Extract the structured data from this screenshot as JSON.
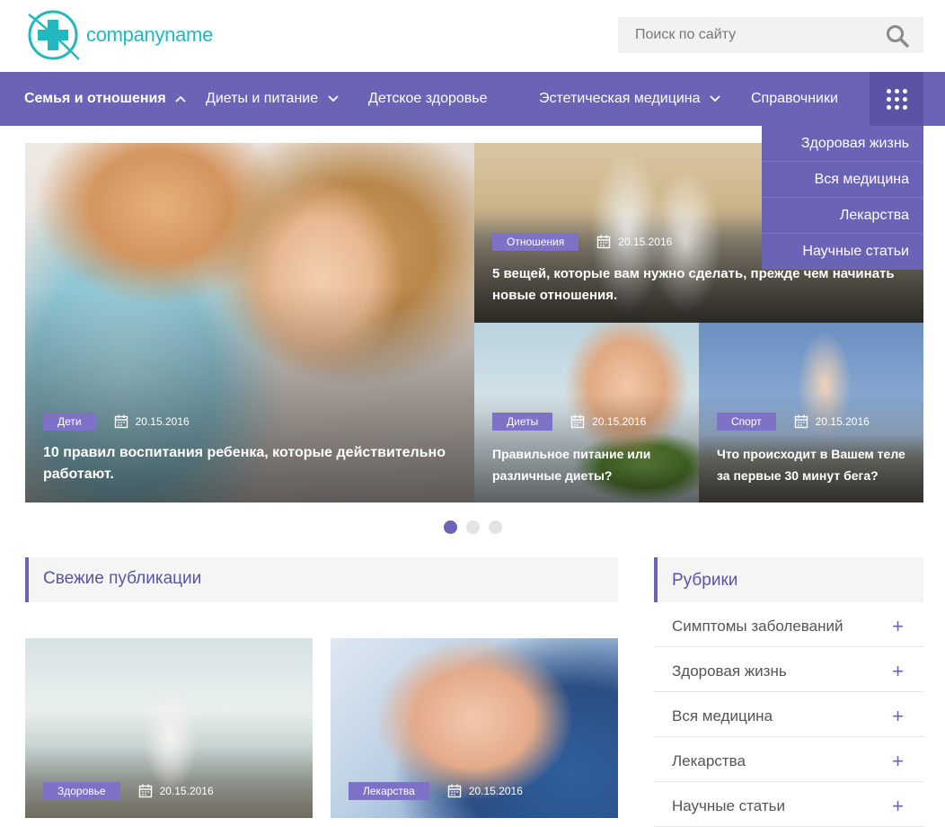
{
  "brand": {
    "name": "companyname",
    "accent": "#23b8c0",
    "nav_color": "#6b63b5"
  },
  "search": {
    "placeholder": "Поиск по сайту",
    "icon": "search-icon"
  },
  "nav": {
    "items": [
      {
        "label": "Семья и отношения",
        "active": true,
        "chevron": "up"
      },
      {
        "label": "Диеты и питание",
        "chevron": "down"
      },
      {
        "label": "Детское здоровье"
      },
      {
        "label": "Эстетическая медицина",
        "chevron": "down"
      },
      {
        "label": "Справочники"
      }
    ],
    "more_icon": "grid-icon"
  },
  "dropdown": {
    "items": [
      "Здоровая жизнь",
      "Вся медицина",
      "Лекарства",
      "Научные статьи"
    ]
  },
  "slider": {
    "tiles": [
      {
        "category": "Дети",
        "date": "20.15.2016",
        "title": "10 правил воспитания ребенка, которые действительно работают."
      },
      {
        "category": "Отношения",
        "date": "20.15.2016",
        "title": "5 вещей, которые вам нужно сделать, прежде чем начинать новые отношения."
      },
      {
        "category": "Диеты",
        "date": "20.15.2016",
        "title": "Правильное питание или различные диеты?"
      },
      {
        "category": "Спорт",
        "date": "20.15.2016",
        "title": "Что происходит в Вашем теле за первые 30 минут бега?"
      }
    ],
    "pages": 3,
    "current_page": 1
  },
  "fresh": {
    "heading": "Свежие публикации",
    "cards": [
      {
        "category": "Здоровье",
        "date": "20.15.2016"
      },
      {
        "category": "Лекарства",
        "date": "20.15.2016"
      }
    ]
  },
  "rubrics": {
    "heading": "Рубрики",
    "items": [
      "Симптомы заболеваний",
      "Здоровая жизнь",
      "Вся медицина",
      "Лекарства",
      "Научные статьи"
    ]
  }
}
